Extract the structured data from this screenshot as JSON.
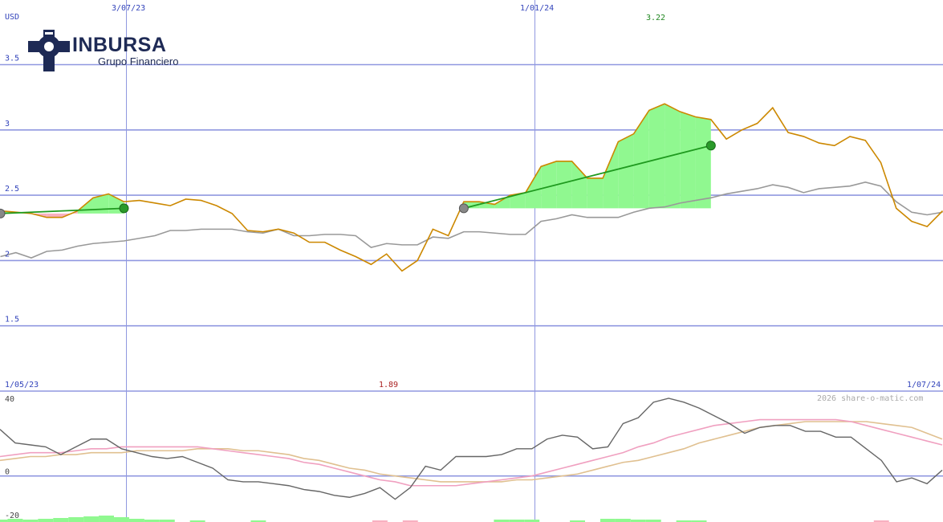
{
  "brand": {
    "name": "INBURSA",
    "subtitle": "Grupo Financiero",
    "color": "#1e2a55"
  },
  "credit": "2026 share-o-matic.com",
  "colors": {
    "price": "#cc8800",
    "average": "#999999",
    "gain_fill": "#90f890",
    "loss_fill": "#f8b0c0",
    "trade_line": "#1f9a1f",
    "grid": "#9098e0",
    "axis_text": "#3344bb",
    "high_text": "#228822",
    "low_text": "#aa2222",
    "osc_main": "#666666",
    "osc_signal1": "#f0a0c0",
    "osc_signal2": "#e0c090"
  },
  "chart_data": [
    {
      "type": "line",
      "unit_label": "USD",
      "y_ticks": [
        "3.5",
        "3",
        "2.5",
        "2",
        "1.5"
      ],
      "y_tick_values": [
        3.5,
        3.0,
        2.5,
        2.0,
        1.5
      ],
      "ylim": [
        1.0,
        3.995
      ],
      "date_labels_top": [
        "3/07/23",
        "1/01/24"
      ],
      "date_labels_bottom": [
        "1/05/23",
        "1/07/24"
      ],
      "period": {
        "start": "1/05/23",
        "end": "1/07/24"
      },
      "high_label": "3.22",
      "low_label": "1.89",
      "grid": true,
      "series": [
        {
          "key": "price",
          "values": [
            2.38,
            2.37,
            2.36,
            2.33,
            2.33,
            2.38,
            2.48,
            2.51,
            2.45,
            2.46,
            2.44,
            2.42,
            2.47,
            2.46,
            2.42,
            2.36,
            2.23,
            2.22,
            2.24,
            2.21,
            2.14,
            2.14,
            2.08,
            2.03,
            1.97,
            2.05,
            1.92,
            2.0,
            2.24,
            2.19,
            2.45,
            2.45,
            2.43,
            2.5,
            2.52,
            2.72,
            2.76,
            2.76,
            2.63,
            2.63,
            2.91,
            2.97,
            3.15,
            3.2,
            3.14,
            3.1,
            3.08,
            2.93,
            3.0,
            3.05,
            3.17,
            2.98,
            2.95,
            2.9,
            2.88,
            2.95,
            2.92,
            2.75,
            2.4,
            2.3,
            2.26,
            2.38
          ]
        },
        {
          "key": "average",
          "values": [
            2.03,
            2.06,
            2.02,
            2.07,
            2.08,
            2.11,
            2.13,
            2.14,
            2.15,
            2.17,
            2.19,
            2.23,
            2.23,
            2.24,
            2.24,
            2.24,
            2.22,
            2.21,
            2.24,
            2.19,
            2.19,
            2.2,
            2.2,
            2.19,
            2.1,
            2.13,
            2.12,
            2.12,
            2.18,
            2.17,
            2.22,
            2.22,
            2.21,
            2.2,
            2.2,
            2.3,
            2.32,
            2.35,
            2.33,
            2.33,
            2.33,
            2.37,
            2.4,
            2.41,
            2.44,
            2.46,
            2.48,
            2.51,
            2.53,
            2.55,
            2.58,
            2.56,
            2.52,
            2.55,
            2.56,
            2.57,
            2.6,
            2.57,
            2.45,
            2.37,
            2.35,
            2.37
          ]
        }
      ],
      "trades": [
        {
          "entry_index": 0,
          "entry_value": 2.36,
          "exit_index": 8,
          "exit_value": 2.4
        },
        {
          "entry_index": 30,
          "entry_value": 2.4,
          "exit_index": 46,
          "exit_value": 2.88
        }
      ]
    },
    {
      "type": "line",
      "y_ticks": [
        "40",
        "0",
        "-20"
      ],
      "y_tick_values": [
        40,
        0,
        -20
      ],
      "ylim": [
        -20,
        40
      ],
      "grid": true,
      "series": [
        {
          "key": "osc_main",
          "values": [
            24,
            17,
            16,
            15,
            11,
            15,
            19,
            19,
            14,
            12,
            10,
            9,
            10,
            7,
            4,
            -2,
            -3,
            -3,
            -4,
            -5,
            -7,
            -8,
            -10,
            -11,
            -9,
            -6,
            -12,
            -6,
            5,
            3,
            10,
            10,
            10,
            11,
            14,
            14,
            19,
            21,
            20,
            14,
            15,
            27,
            30,
            38,
            40,
            38,
            35,
            31,
            27,
            22,
            25,
            26,
            26,
            23,
            23,
            20,
            20,
            14,
            8,
            -3,
            -1,
            -4,
            3
          ]
        },
        {
          "key": "osc_signal1",
          "values": [
            10,
            11,
            12,
            12,
            12,
            13,
            14,
            14,
            15,
            15,
            15,
            15,
            15,
            15,
            14,
            13,
            12,
            11,
            10,
            9,
            7,
            6,
            4,
            2,
            0,
            -2,
            -3,
            -5,
            -5,
            -5,
            -5,
            -4,
            -3,
            -2,
            -1,
            0,
            2,
            4,
            6,
            8,
            10,
            12,
            15,
            17,
            20,
            22,
            24,
            26,
            27,
            28,
            29,
            29,
            29,
            29,
            29,
            29,
            28,
            26,
            24,
            22,
            20,
            18,
            16
          ]
        },
        {
          "key": "osc_signal2",
          "values": [
            8,
            9,
            10,
            10,
            11,
            11,
            12,
            12,
            12,
            13,
            13,
            13,
            13,
            14,
            14,
            14,
            13,
            13,
            12,
            11,
            9,
            8,
            6,
            4,
            3,
            1,
            0,
            -1,
            -2,
            -3,
            -3,
            -3,
            -3,
            -3,
            -2,
            -2,
            -1,
            0,
            1,
            3,
            5,
            7,
            8,
            10,
            12,
            14,
            17,
            19,
            21,
            23,
            25,
            26,
            27,
            28,
            28,
            28,
            28,
            28,
            27,
            26,
            25,
            22,
            19
          ]
        }
      ],
      "volume_bars": [
        {
          "index": 0,
          "value": 3,
          "color": "gain"
        },
        {
          "index": 1,
          "value": 4,
          "color": "gain"
        },
        {
          "index": 2,
          "value": 3,
          "color": "gain"
        },
        {
          "index": 3,
          "value": 4,
          "color": "gain"
        },
        {
          "index": 4,
          "value": 5,
          "color": "gain"
        },
        {
          "index": 5,
          "value": 6,
          "color": "gain"
        },
        {
          "index": 6,
          "value": 7,
          "color": "gain"
        },
        {
          "index": 7,
          "value": 8,
          "color": "gain"
        },
        {
          "index": 8,
          "value": 6,
          "color": "gain"
        },
        {
          "index": 9,
          "value": 4,
          "color": "gain"
        },
        {
          "index": 10,
          "value": 3,
          "color": "gain"
        },
        {
          "index": 11,
          "value": 3,
          "color": "gain"
        },
        {
          "index": 13,
          "value": 2,
          "color": "gain"
        },
        {
          "index": 17,
          "value": 2,
          "color": "gain"
        },
        {
          "index": 25,
          "value": 2,
          "color": "loss"
        },
        {
          "index": 27,
          "value": 2,
          "color": "loss"
        },
        {
          "index": 33,
          "value": 3,
          "color": "gain"
        },
        {
          "index": 34,
          "value": 3,
          "color": "gain"
        },
        {
          "index": 35,
          "value": 3,
          "color": "gain"
        },
        {
          "index": 38,
          "value": 2,
          "color": "gain"
        },
        {
          "index": 40,
          "value": 4,
          "color": "gain"
        },
        {
          "index": 41,
          "value": 4,
          "color": "gain"
        },
        {
          "index": 42,
          "value": 3,
          "color": "gain"
        },
        {
          "index": 43,
          "value": 3,
          "color": "gain"
        },
        {
          "index": 45,
          "value": 2,
          "color": "gain"
        },
        {
          "index": 46,
          "value": 2,
          "color": "gain"
        },
        {
          "index": 58,
          "value": 2,
          "color": "loss"
        }
      ]
    }
  ]
}
